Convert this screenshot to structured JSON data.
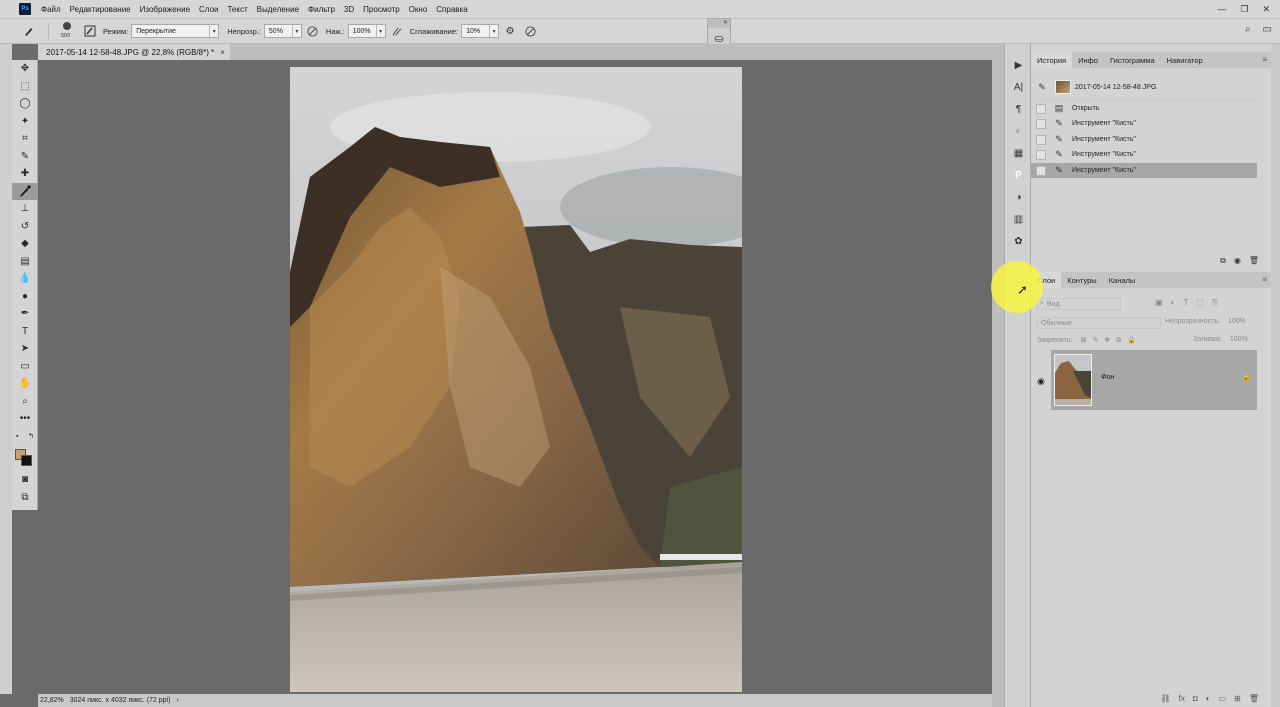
{
  "menubar": {
    "logo": "Ps",
    "items": [
      "Файл",
      "Редактирование",
      "Изображение",
      "Слои",
      "Текст",
      "Выделение",
      "Фильтр",
      "3D",
      "Просмотр",
      "Окно",
      "Справка"
    ],
    "win_controls": [
      "—",
      "❐",
      "✕"
    ]
  },
  "options": {
    "brush_size": "500",
    "mode_label": "Режим:",
    "mode_value": "Перекрытие",
    "opacity_label": "Непрозр.:",
    "opacity_value": "50%",
    "pressure_label": "Наж.:",
    "pressure_value": "100%",
    "smoothing_label": "Сглаживание:",
    "smoothing_value": "10%"
  },
  "document": {
    "tab_title": "2017-05-14 12-58-48.JPG @ 22,8% (RGB/8*) *",
    "close": "×"
  },
  "status": {
    "zoom": "22,82%",
    "dimensions": "3024 пикс. x 4032 пикс. (72 ppi)",
    "arrow": "›"
  },
  "history": {
    "tabs": [
      "История",
      "Инфо",
      "Гистограмма",
      "Навигатор"
    ],
    "snapshot": "2017-05-14 12-58-48.JPG",
    "steps": [
      {
        "label": "Открыть",
        "icon": "document-icon"
      },
      {
        "label": "Инструмент \"Кисть\"",
        "icon": "brush-icon"
      },
      {
        "label": "Инструмент \"Кисть\"",
        "icon": "brush-icon"
      },
      {
        "label": "Инструмент \"Кисть\"",
        "icon": "brush-icon"
      },
      {
        "label": "Инструмент \"Кисть\"",
        "icon": "brush-icon"
      }
    ],
    "selected_index": 4
  },
  "layers": {
    "tabs": [
      "Слои",
      "Контуры",
      "Каналы"
    ],
    "filter_placeholder": "Вид",
    "blend_mode": "Обычные",
    "opacity_label": "Непрозрачность:",
    "opacity_value": "100%",
    "lock_label": "Закрепить:",
    "fill_label": "Заливка:",
    "fill_value": "100%",
    "layer_name": "Фон"
  },
  "colors": {
    "accent": "#31a8ff",
    "foreground": "#c8a070",
    "background": "#111111",
    "highlight": "#faf53c"
  }
}
